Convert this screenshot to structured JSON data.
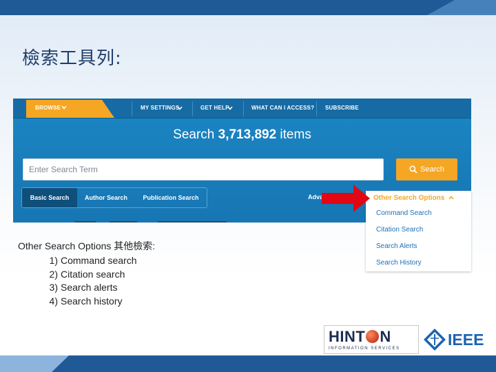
{
  "slide": {
    "title": "檢索工具列:"
  },
  "nav": {
    "browse_label": "BROWSE",
    "my_settings_label": "MY SETTINGS",
    "get_help_label": "GET HELP",
    "what_can_i_access_label": "WHAT CAN I ACCESS?",
    "subscribe_label": "SUBSCRIBE"
  },
  "search": {
    "heading_prefix": "Search ",
    "heading_count": "3,713,892",
    "heading_suffix": " items",
    "placeholder": "Enter Search Term",
    "button_label": "Search",
    "tabs": [
      {
        "label": "Basic Search",
        "active": true
      },
      {
        "label": "Author Search",
        "active": false
      },
      {
        "label": "Publication Search",
        "active": false
      }
    ],
    "advanced_label": "Adva"
  },
  "dropdown": {
    "header": "Other Search Options",
    "items": [
      "Command Search",
      "Citation Search",
      "Search Alerts",
      "Search History"
    ]
  },
  "note": {
    "title": "Other Search Options 其他檢索:",
    "items": [
      {
        "num": "1)",
        "text": "Command search"
      },
      {
        "num": "2)",
        "text": "Citation search"
      },
      {
        "num": "3)",
        "text": "Search alerts"
      },
      {
        "num": "4)",
        "text": "Search history"
      }
    ]
  },
  "logos": {
    "hinton_prefix": "HINT",
    "hinton_suffix": "N",
    "hinton_sub": "INFORMATION SERVICES",
    "ieee": "IEEE"
  },
  "colors": {
    "accent_orange": "#f5a623",
    "xplore_blue": "#1b86c4",
    "arrow_red": "#e30613",
    "slide_blue": "#1f5a96"
  },
  "icons": {
    "browse_chevron": "chevron-down-icon",
    "search_button": "magnifier-icon",
    "dropdown_chevron": "chevron-up-icon",
    "pointer": "red-arrow-icon"
  }
}
